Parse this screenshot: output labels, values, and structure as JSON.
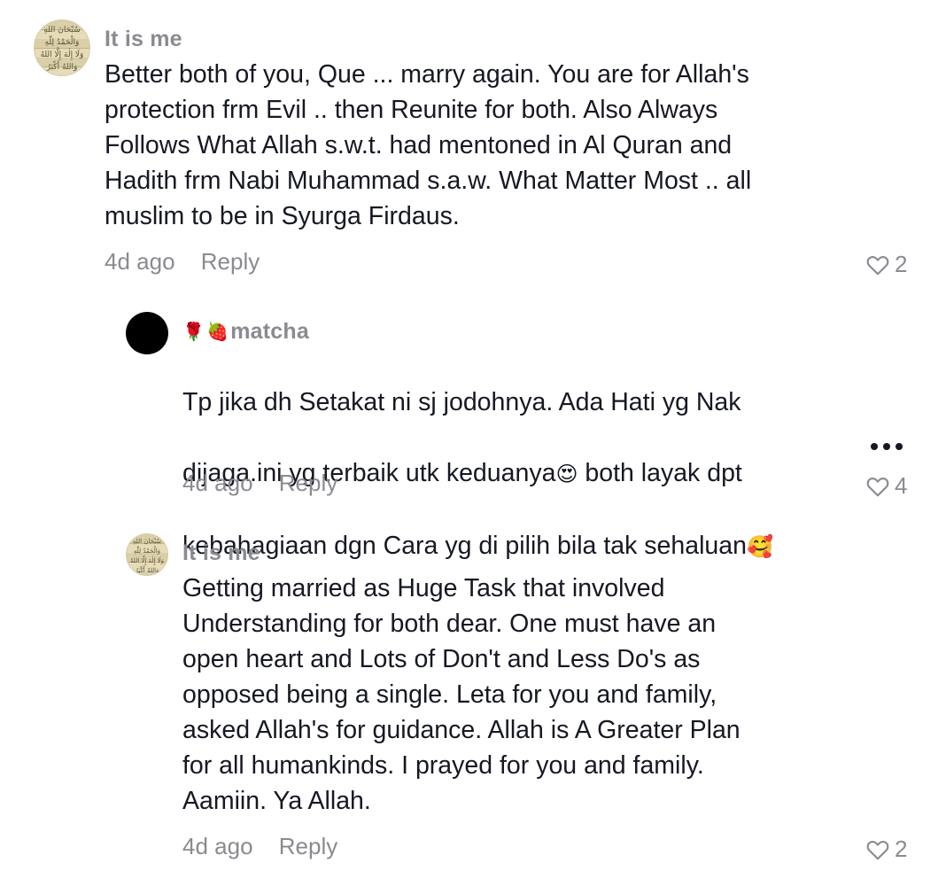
{
  "comments": [
    {
      "username": "It is me",
      "text": "Better both of you, Que ... marry again. You are for Allah's\nprotection frm Evil .. then Reunite for both. Also Always\nFollows What Allah s.w.t. had mentoned in Al Quran and\nHadith frm Nabi Muhammad s.a.w. What Matter Most .. all\nmuslim to be in Syurga Firdaus.",
      "time": "4d ago",
      "reply": "Reply",
      "likes": "2"
    },
    {
      "username": "matcha",
      "username_emoji": [
        "rose-icon",
        "strawberry-icon"
      ],
      "text_line1": "Tp jika dh Setakat ni sj jodohnya. Ada Hati yg Nak",
      "text_line2a": "dijaga.ini yg terbaik utk keduanya",
      "text_line2b": " both layak dpt",
      "text_line3": "kebahagiaan dgn Cara yg di pilih bila tak sehaluan",
      "time": "4d ago",
      "reply": "Reply",
      "likes": "4"
    },
    {
      "username": "It is me",
      "text": "Getting married as Huge Task that involved\nUnderstanding for both dear. One must have an\nopen heart and Lots of Don't and Less Do's as\nopposed being a single. Leta for you and family,\nasked Allah's for guidance. Allah is A Greater Plan\nfor all humankinds. I prayed for you and family.\nAamiin. Ya Allah.",
      "time": "4d ago",
      "reply": "Reply",
      "likes": "2"
    }
  ]
}
